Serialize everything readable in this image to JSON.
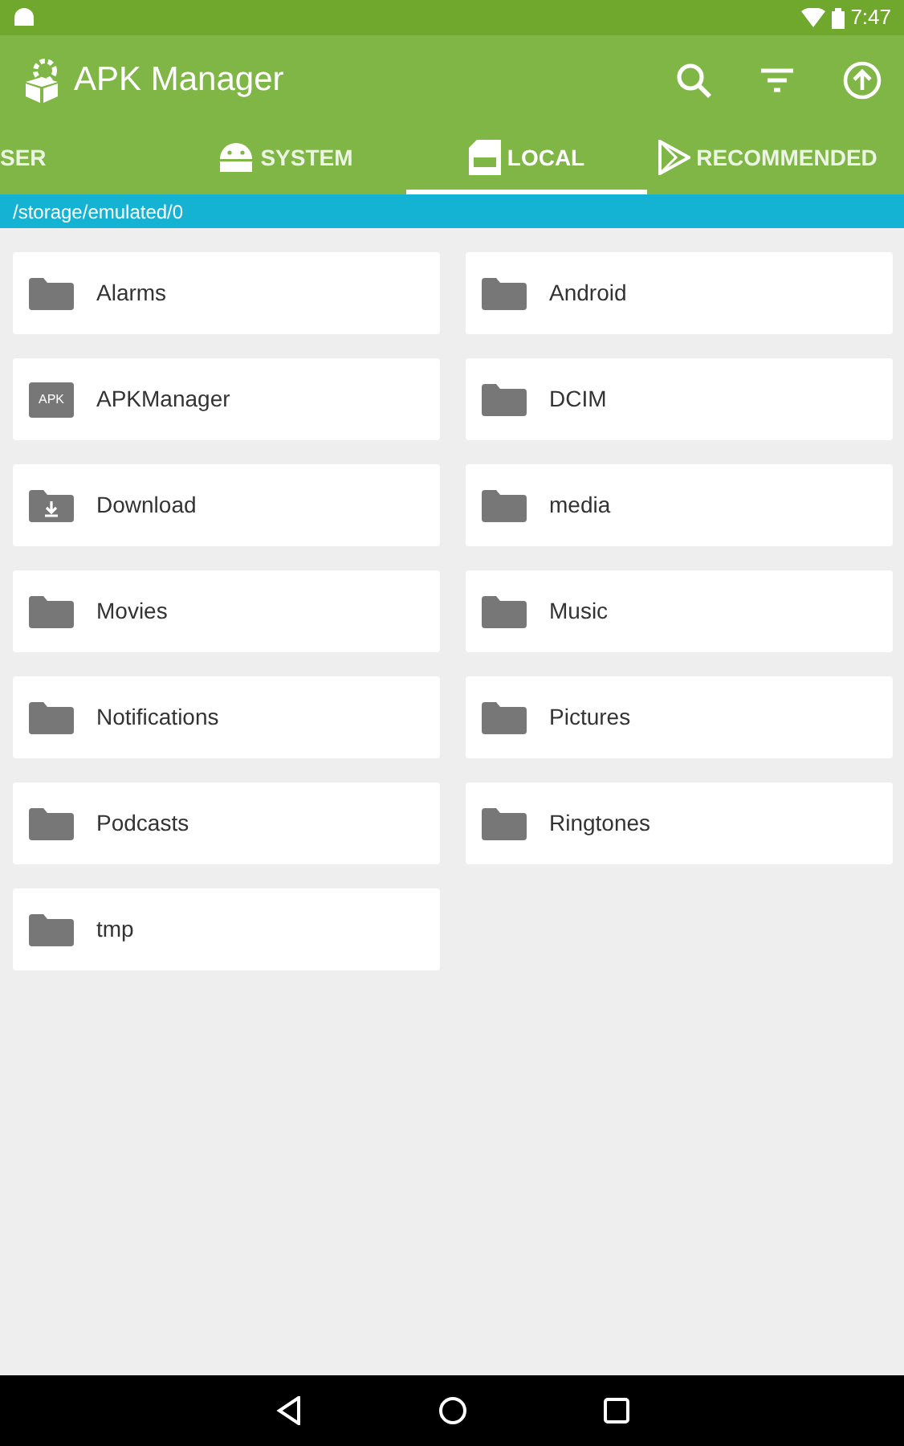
{
  "status_bar": {
    "time": "7:47"
  },
  "app_bar": {
    "title": "APK Manager"
  },
  "tabs": [
    {
      "label": "SER",
      "kind": "cut",
      "selected": false
    },
    {
      "label": "SYSTEM",
      "kind": "android",
      "selected": false
    },
    {
      "label": "LOCAL",
      "kind": "apk",
      "selected": true
    },
    {
      "label": "RECOMMENDED",
      "kind": "play",
      "selected": false
    }
  ],
  "path": "/storage/emulated/0",
  "folders": [
    {
      "name": "Alarms",
      "kind": "folder"
    },
    {
      "name": "Android",
      "kind": "folder"
    },
    {
      "name": "APKManager",
      "kind": "apk",
      "icon_label": "APK"
    },
    {
      "name": "DCIM",
      "kind": "folder"
    },
    {
      "name": "Download",
      "kind": "download"
    },
    {
      "name": "media",
      "kind": "folder"
    },
    {
      "name": "Movies",
      "kind": "folder"
    },
    {
      "name": "Music",
      "kind": "folder"
    },
    {
      "name": "Notifications",
      "kind": "folder"
    },
    {
      "name": "Pictures",
      "kind": "folder"
    },
    {
      "name": "Podcasts",
      "kind": "folder"
    },
    {
      "name": "Ringtones",
      "kind": "folder"
    },
    {
      "name": "tmp",
      "kind": "folder"
    }
  ]
}
